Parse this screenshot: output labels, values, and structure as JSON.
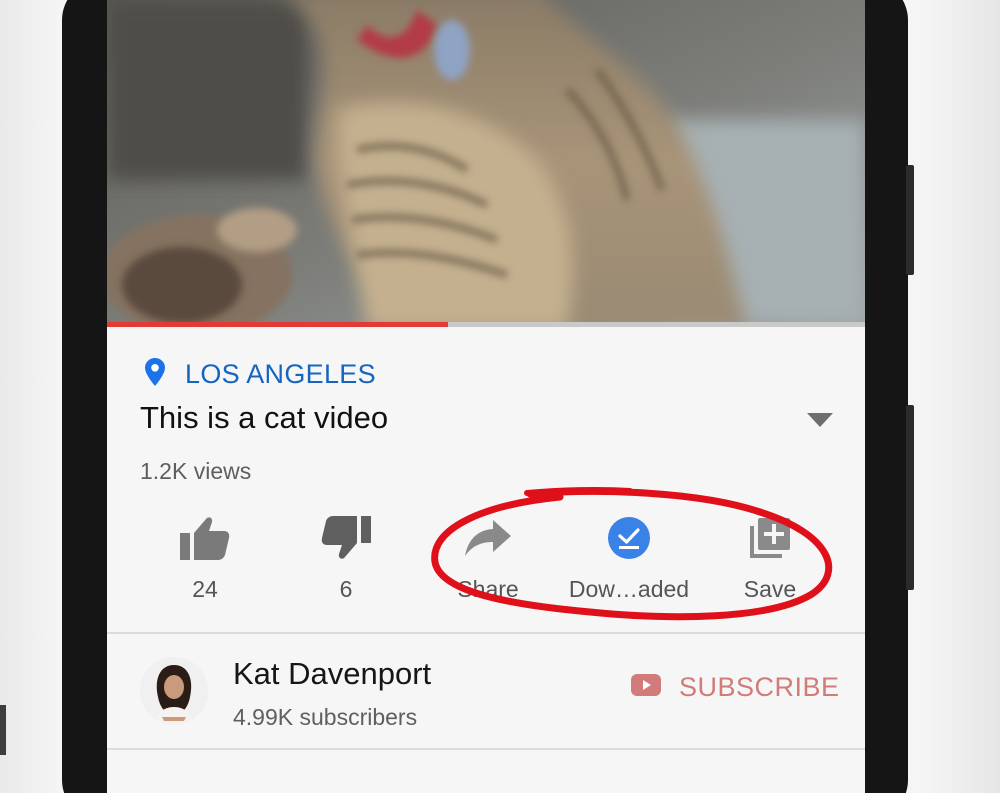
{
  "video": {
    "progress": 0.45,
    "location": "LOS ANGELES",
    "title": "This is a cat video",
    "views": "1.2K views"
  },
  "actions": [
    {
      "id": "like",
      "label": "24",
      "icon": "thumbs-up-icon"
    },
    {
      "id": "dislike",
      "label": "6",
      "icon": "thumbs-down-icon"
    },
    {
      "id": "share",
      "label": "Share",
      "icon": "share-arrow-icon"
    },
    {
      "id": "download",
      "label": "Dow…aded",
      "icon": "downloaded-check-icon"
    },
    {
      "id": "save",
      "label": "Save",
      "icon": "add-to-playlist-icon"
    }
  ],
  "channel": {
    "name": "Kat Davenport",
    "subscribers": "4.99K subscribers",
    "subscribe_label": "SUBSCRIBE"
  },
  "colors": {
    "accent_red": "#e53935",
    "link_blue": "#1565c0",
    "download_blue": "#3b82e8",
    "annotation_red": "#e0101a"
  }
}
